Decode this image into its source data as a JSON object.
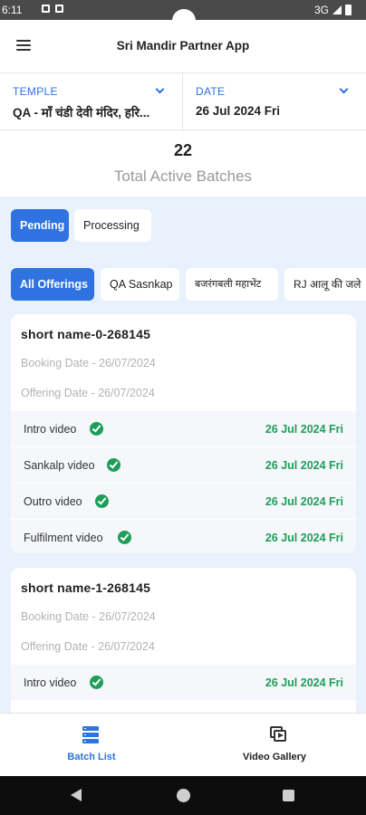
{
  "status_bar": {
    "time": "6:11",
    "network": "3G"
  },
  "app_bar": {
    "title": "Sri Mandir Partner App"
  },
  "temple_selector": {
    "label": "TEMPLE",
    "value": "QA - माँ चंडी देवी मंदिर, हरि..."
  },
  "date_selector": {
    "label": "DATE",
    "value": "26 Jul 2024 Fri"
  },
  "summary": {
    "count": "22",
    "caption": "Total Active Batches"
  },
  "status_tabs": [
    {
      "label": "Pending",
      "active": true
    },
    {
      "label": "Processing",
      "active": false
    }
  ],
  "offering_filters": [
    {
      "label": "All Offerings",
      "active": true
    },
    {
      "label": "QA Sasnkap",
      "active": false
    },
    {
      "label": "बजरंगबली महाभेंट",
      "active": false
    },
    {
      "label": "RJ आलू की जले",
      "active": false
    }
  ],
  "batches": [
    {
      "name": "short name-0-268145",
      "booking_date": "Booking Date - 26/07/2024",
      "offering_date": "Offering Date - 26/07/2024",
      "videos": [
        {
          "label": "Intro video",
          "date": "26 Jul 2024 Fri"
        },
        {
          "label": "Sankalp video",
          "date": "26 Jul 2024 Fri"
        },
        {
          "label": "Outro video",
          "date": "26 Jul 2024 Fri"
        },
        {
          "label": "Fulfilment video",
          "date": "26 Jul 2024 Fri"
        }
      ]
    },
    {
      "name": "short name-1-268145",
      "booking_date": "Booking Date - 26/07/2024",
      "offering_date": "Offering Date - 26/07/2024",
      "videos": [
        {
          "label": "Intro video",
          "date": "26 Jul 2024 Fri"
        }
      ]
    }
  ],
  "bottom_nav": [
    {
      "label": "Batch List",
      "icon": "batch-list-icon",
      "active": true
    },
    {
      "label": "Video Gallery",
      "icon": "video-gallery-icon",
      "active": false
    }
  ],
  "colors": {
    "accent": "#2f73e0",
    "success": "#1e9e5a",
    "content_bg": "#e9f1fc"
  }
}
